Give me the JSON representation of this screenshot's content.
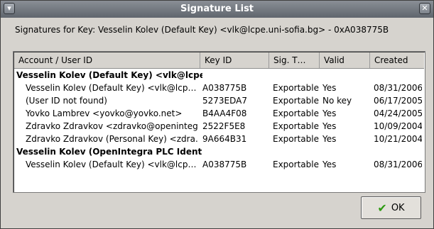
{
  "window": {
    "title": "Signature List"
  },
  "signatures_label": "Signatures for Key:   Vesselin Kolev (Default Key) <vlk@lcpe.uni-sofia.bg> - 0xA038775B",
  "table": {
    "columns": [
      "Account / User ID",
      "Key ID",
      "Sig. T…",
      "Valid",
      "Created"
    ],
    "rows": [
      {
        "kind": "group",
        "user": "Vesselin Kolev (Default Key) <vlk@lcpe…",
        "key_id": "",
        "sig_type": "",
        "valid": "",
        "created": ""
      },
      {
        "kind": "sig",
        "user": "Vesselin Kolev (Default Key) <vlk@lcp…",
        "key_id": "A038775B",
        "sig_type": "Exportable",
        "valid": "Yes",
        "created": "08/31/2006"
      },
      {
        "kind": "sig",
        "user": "(User ID not found)",
        "key_id": "5273EDA7",
        "sig_type": "Exportable",
        "valid": "No key",
        "created": "06/17/2005"
      },
      {
        "kind": "sig",
        "user": "Yovko Lambrev <yovko@yovko.net>",
        "key_id": "B4AA4F08",
        "sig_type": "Exportable",
        "valid": "Yes",
        "created": "04/24/2005"
      },
      {
        "kind": "sig",
        "user": "Zdravko Zdravkov <zdravko@openinteg…",
        "key_id": "2522F5E8",
        "sig_type": "Exportable",
        "valid": "Yes",
        "created": "10/09/2004"
      },
      {
        "kind": "sig",
        "user": "Zdravko Zdravkov (Personal Key) <zdra…",
        "key_id": "9A664B31",
        "sig_type": "Exportable",
        "valid": "Yes",
        "created": "10/21/2004"
      },
      {
        "kind": "group",
        "user": "Vesselin Kolev (OpenIntegra PLC Ident…",
        "key_id": "",
        "sig_type": "",
        "valid": "",
        "created": ""
      },
      {
        "kind": "sig",
        "user": "Vesselin Kolev (Default Key) <vlk@lcp…",
        "key_id": "A038775B",
        "sig_type": "Exportable",
        "valid": "Yes",
        "created": "08/31/2006"
      }
    ]
  },
  "ok_button": {
    "label": "OK",
    "icon": "checkmark-icon"
  },
  "titlebar_buttons": {
    "menu_icon": "window-menu-icon",
    "close_icon": "close-icon"
  }
}
